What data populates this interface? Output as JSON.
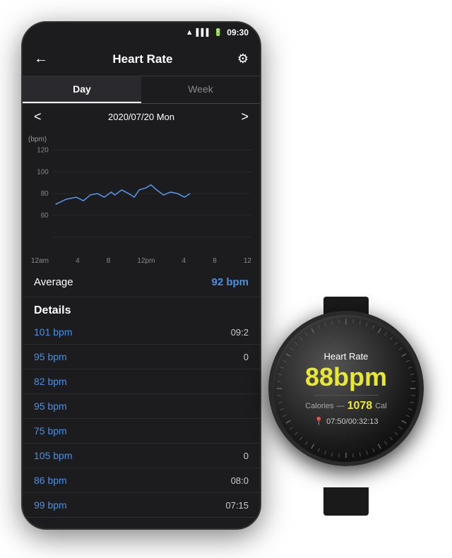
{
  "statusBar": {
    "time": "09:30",
    "icons": [
      "wifi",
      "signal",
      "battery"
    ]
  },
  "header": {
    "title": "Heart Rate",
    "backLabel": "←",
    "settingsLabel": "⚙"
  },
  "tabs": [
    {
      "label": "Day",
      "active": true
    },
    {
      "label": "Week",
      "active": false
    }
  ],
  "dateNav": {
    "prev": "<",
    "next": ">",
    "date": "2020/07/20 Mon"
  },
  "chart": {
    "yLabel": "(bpm)",
    "yValues": [
      "120",
      "100",
      "80",
      "60"
    ],
    "xLabels": [
      "12am",
      "4",
      "8",
      "12pm",
      "4",
      "8",
      "12"
    ]
  },
  "average": {
    "label": "Average",
    "value": "92 bpm"
  },
  "details": {
    "title": "Details",
    "rows": [
      {
        "bpm": "101 bpm",
        "time": "09:2"
      },
      {
        "bpm": "95 bpm",
        "time": "0"
      },
      {
        "bpm": "82 bpm",
        "time": ""
      },
      {
        "bpm": "95 bpm",
        "time": ""
      },
      {
        "bpm": "75 bpm",
        "time": ""
      },
      {
        "bpm": "105 bpm",
        "time": "0"
      },
      {
        "bpm": "86 bpm",
        "time": "08:0"
      },
      {
        "bpm": "99 bpm",
        "time": "07:15"
      }
    ]
  },
  "watch": {
    "title": "Heart Rate",
    "bpm": "88bpm",
    "caloriesLabel": "Calories",
    "caloriesDash": "—",
    "caloriesValue": "1078",
    "caloriesUnit": "Cal",
    "locationIcon": "📍",
    "timeText": "07:50/00:32:13"
  }
}
